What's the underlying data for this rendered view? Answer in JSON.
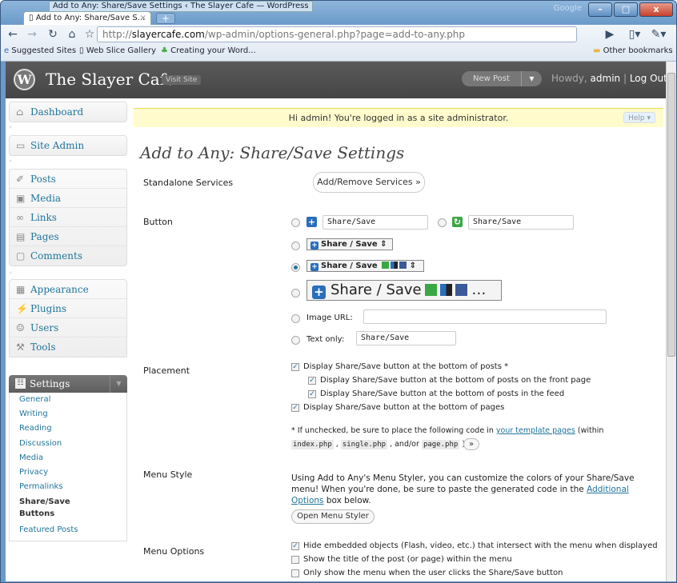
{
  "browser": {
    "window_title": "Add to Any: Share/Save Settings ‹ The Slayer Cafe — WordPress",
    "google_label": "Google",
    "tab_title": "Add to Any: Share/Save S...",
    "url_prefix": "http://",
    "url_domain": "slayercafe.com",
    "url_path": "/wp-admin/options-general.php?page=add-to-any.php",
    "bookmarks": [
      "Suggested Sites",
      "Web Slice Gallery",
      "Creating your Word...",
      "Other bookmarks"
    ]
  },
  "wp": {
    "site_name": "The Slayer Cafe",
    "visit_site": "Visit Site",
    "new_post": "New Post",
    "howdy_prefix": "Howdy,",
    "user": "admin",
    "logout": "Log Out"
  },
  "sidebar": {
    "dashboard": "Dashboard",
    "site_admin": "Site Admin",
    "content": [
      "Posts",
      "Media",
      "Links",
      "Pages",
      "Comments"
    ],
    "appearance": [
      "Appearance",
      "Plugins",
      "Users",
      "Tools"
    ],
    "settings": "Settings",
    "submenu": [
      "General",
      "Writing",
      "Reading",
      "Discussion",
      "Media",
      "Privacy",
      "Permalinks",
      "Share/Save Buttons",
      "Featured Posts"
    ]
  },
  "main": {
    "notice": "Hi admin! You're logged in as a site administrator.",
    "help": "Help",
    "title": "Add to Any: Share/Save Settings",
    "standalone_label": "Standalone Services",
    "add_remove_button": "Add/Remove Services »",
    "button_label": "Button",
    "share_text_1": "Share/Save",
    "share_text_2": "Share/Save",
    "btn_small": "Share / Save",
    "btn_small_icons": "Share / Save",
    "btn_big": "Share / Save",
    "image_url_label": "Image URL:",
    "text_only_label": "Text only:",
    "text_only_value": "Share/Save",
    "placement_label": "Placement",
    "placement": [
      "Display Share/Save button at the bottom of posts *",
      "Display Share/Save button at the bottom of posts on the front page",
      "Display Share/Save button at the bottom of posts in the feed",
      "Display Share/Save button at the bottom of pages"
    ],
    "unchecked_note_1": "* If unchecked, be sure to place the following code in ",
    "template_link": "your template pages",
    "unchecked_note_2": " (within",
    "code_1": "index.php",
    "code_2": "single.php",
    "code_3": "page.php",
    "and_or": ", and/or",
    "expand": "»",
    "menu_style_label": "Menu Style",
    "menu_style_text_1": "Using Add to Any's Menu Styler, you can customize the colors of your Share/Save",
    "menu_style_text_2": "menu! When you're done, be sure to paste the generated code in the ",
    "additional_link_1": "Additional",
    "additional_link_2": "Options",
    "menu_style_text_3": " box below.",
    "open_styler": "Open Menu Styler",
    "menu_options_label": "Menu Options",
    "menu_options": [
      "Hide embedded objects (Flash, video, etc.) that intersect with the menu when displayed",
      "Show the title of the post (or page) within the menu",
      "Only show the menu when the user clicks the Share/Save button"
    ]
  }
}
